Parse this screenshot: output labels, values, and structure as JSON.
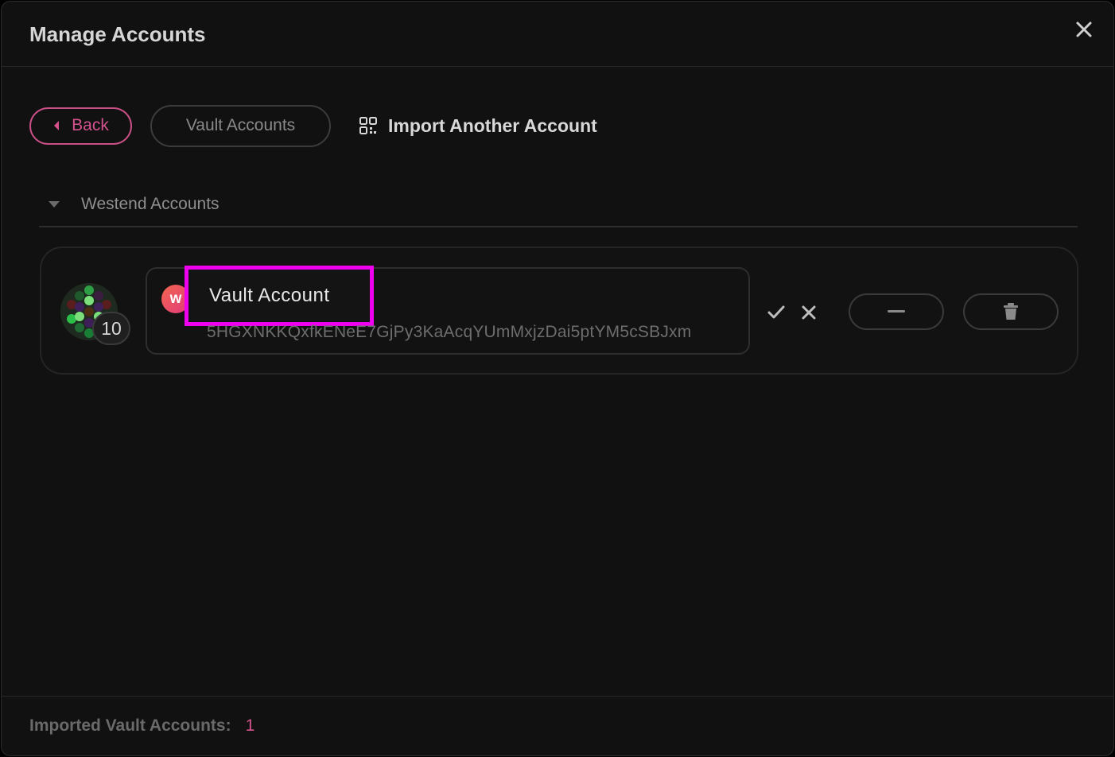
{
  "modal": {
    "title": "Manage Accounts",
    "close_icon": "close-icon"
  },
  "toolbar": {
    "back_label": "Back",
    "vault_accounts_label": "Vault Accounts",
    "import_label": "Import Another Account"
  },
  "section": {
    "label": "Westend Accounts"
  },
  "account": {
    "index": "10",
    "network_letter": "w",
    "name": "Vault Account",
    "address": "5HGXNKKQxfkENeE7GjPy3KaAcqYUmMxjzDai5ptYM5cSBJxm"
  },
  "footer": {
    "label": "Imported Vault Accounts:",
    "count": "1"
  },
  "colors": {
    "accent": "#d4538e",
    "highlight": "#ee00ee",
    "background": "#111111"
  }
}
